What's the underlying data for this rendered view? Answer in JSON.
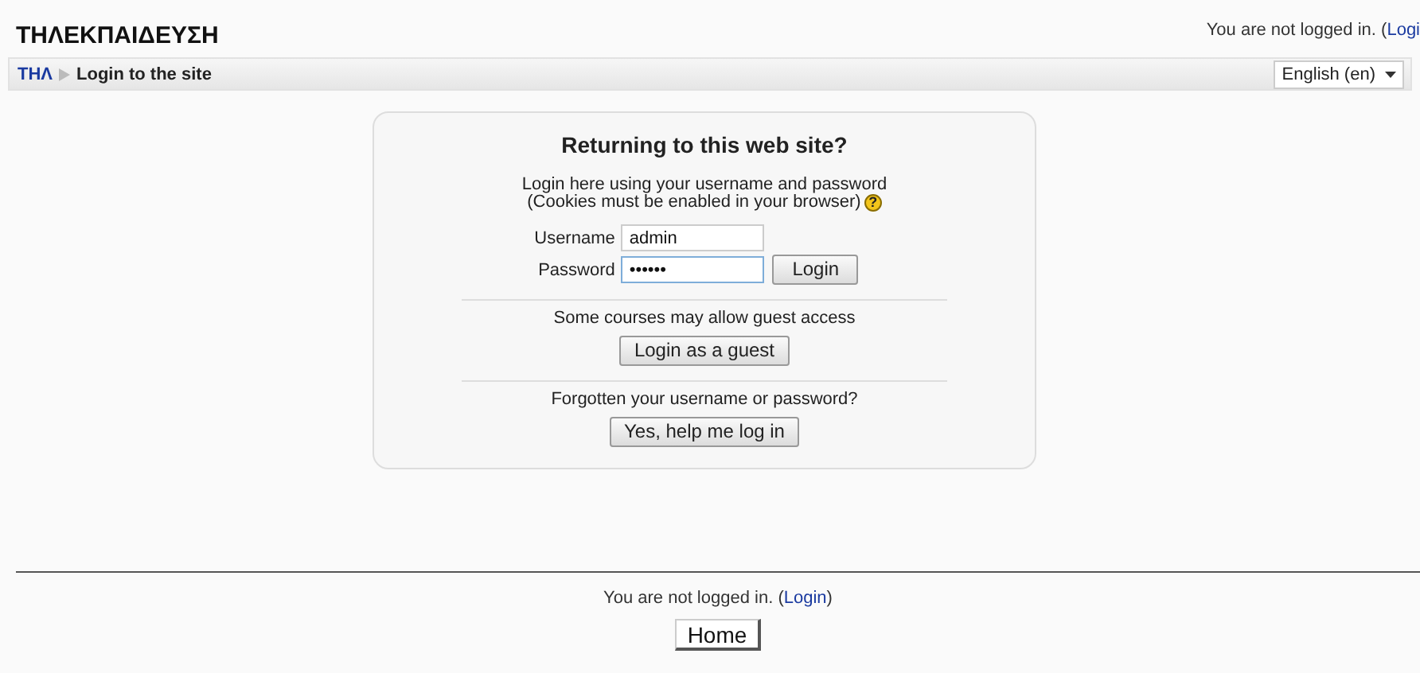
{
  "header": {
    "site_name": "ΤΗΛΕΚΠΑΙΔΕΥΣΗ",
    "login_info_text": "You are not logged in. (",
    "login_info_link": "Logi"
  },
  "navbar": {
    "breadcrumb": [
      {
        "label": "ΤΗΛ",
        "link": true
      },
      {
        "label": "Login to the site",
        "link": false
      }
    ],
    "language": "English (en)"
  },
  "login": {
    "heading": "Returning to this web site?",
    "instructions": [
      "Login here using your username and password",
      "(Cookies must be enabled in your browser)"
    ],
    "help_icon": "?",
    "fields": [
      {
        "label": "Username",
        "value": "admin",
        "focused": false
      },
      {
        "label": "Password",
        "value": "••••••",
        "focused": true
      }
    ],
    "login_button": "Login",
    "guest_text": "Some courses may allow guest access",
    "guest_button": "Login as a guest",
    "forgot_text": "Forgotten your username or password?",
    "forgot_button": "Yes, help me log in"
  },
  "footer": {
    "login_info_text": "You are not logged in. (",
    "login_link": "Login",
    "login_info_end": ")",
    "home_button": "Home"
  }
}
